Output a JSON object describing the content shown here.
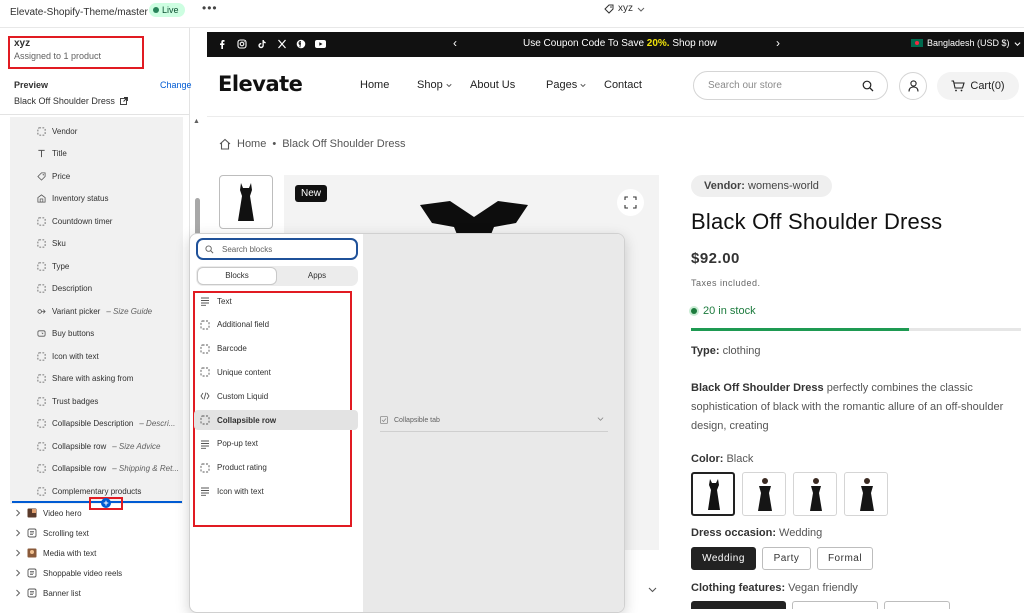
{
  "topbar": {
    "theme_name": "Elevate-Shopify-Theme/master",
    "live_label": "Live",
    "template_name": "xyz",
    "more_label": "•••"
  },
  "sidebar": {
    "template_title": "xyz",
    "template_sub": "Assigned to 1 product",
    "preview_label": "Preview",
    "preview_change": "Change",
    "preview_product": "Black Off Shoulder Dress",
    "blocks": [
      {
        "label": "Vendor",
        "sub": "",
        "icon": "dashed-square-icon"
      },
      {
        "label": "Title",
        "sub": "",
        "icon": "text-t-icon"
      },
      {
        "label": "Price",
        "sub": "",
        "icon": "price-tag-icon"
      },
      {
        "label": "Inventory status",
        "sub": "",
        "icon": "inventory-icon"
      },
      {
        "label": "Countdown timer",
        "sub": "",
        "icon": "dashed-square-icon"
      },
      {
        "label": "Sku",
        "sub": "",
        "icon": "dashed-square-icon"
      },
      {
        "label": "Type",
        "sub": "",
        "icon": "dashed-square-icon"
      },
      {
        "label": "Description",
        "sub": "",
        "icon": "dashed-square-icon"
      },
      {
        "label": "Variant picker",
        "sub": "Size Guide",
        "icon": "variant-picker-icon"
      },
      {
        "label": "Buy buttons",
        "sub": "",
        "icon": "buy-buttons-icon"
      },
      {
        "label": "Icon with text",
        "sub": "",
        "icon": "dashed-square-icon"
      },
      {
        "label": "Share with asking from",
        "sub": "",
        "icon": "dashed-square-icon"
      },
      {
        "label": "Trust badges",
        "sub": "",
        "icon": "dashed-square-icon"
      },
      {
        "label": "Collapsible Description",
        "sub": "Descri...",
        "icon": "dashed-square-icon"
      },
      {
        "label": "Collapsible row",
        "sub": "Size Advice",
        "icon": "dashed-square-icon"
      },
      {
        "label": "Collapsible row",
        "sub": "Shipping & Ret...",
        "icon": "dashed-square-icon"
      },
      {
        "label": "Complementary products",
        "sub": "",
        "icon": "dashed-square-icon"
      }
    ],
    "sections": [
      {
        "label": "Video hero",
        "icon": "video-thumb-icon"
      },
      {
        "label": "Scrolling text",
        "icon": "section-icon"
      },
      {
        "label": "Media with text",
        "icon": "media-thumb-icon"
      },
      {
        "label": "Shoppable video reels",
        "icon": "section-icon"
      },
      {
        "label": "Banner list",
        "icon": "section-icon"
      }
    ],
    "add_block_symbol": "+"
  },
  "store": {
    "announcement": {
      "text_pre": "Use Coupon Code To Save ",
      "highlight": "20%.",
      "text_post": " Shop now",
      "prev": "‹",
      "next": "›"
    },
    "country": "Bangladesh (USD $)",
    "logo": "Elevate",
    "nav": [
      "Home",
      "Shop",
      "About Us",
      "Pages",
      "Contact"
    ],
    "search_placeholder": "Search our store",
    "cart_label": "Cart(0)",
    "breadcrumb": {
      "home": "Home",
      "separator": "•",
      "current": "Black Off Shoulder Dress"
    },
    "new_badge": "New"
  },
  "product": {
    "vendor_label": "Vendor:",
    "vendor_value": " womens-world",
    "title": "Black Off Shoulder Dress",
    "price": "$92.00",
    "taxes": "Taxes included.",
    "stock_text": "20 in stock",
    "stock_fraction": 0.66,
    "type_label": "Type:",
    "type_value": " clothing",
    "desc_bold": "Black Off Shoulder Dress",
    "desc_rest": " perfectly combines the classic sophistication of black with the romantic allure of an off-shoulder design, creating",
    "color_label": "Color:",
    "color_value": " Black",
    "occasion_label": "Dress occasion:",
    "occasion_value": " Wedding",
    "occasions": [
      "Wedding",
      "Party",
      "Formal"
    ],
    "features_label": "Clothing features:",
    "features_value": " Vegan friendly"
  },
  "picker": {
    "search_placeholder": "Search blocks",
    "tab_blocks": "Blocks",
    "tab_apps": "Apps",
    "items": [
      {
        "label": "Text",
        "icon": "text-lines-icon"
      },
      {
        "label": "Additional field",
        "icon": "dashed-square-icon"
      },
      {
        "label": "Barcode",
        "icon": "dashed-square-icon"
      },
      {
        "label": "Unique content",
        "icon": "dashed-square-icon"
      },
      {
        "label": "Custom Liquid",
        "icon": "code-icon"
      },
      {
        "label": "Collapsible row",
        "icon": "dashed-square-icon"
      },
      {
        "label": "Pop-up text",
        "icon": "text-lines-icon"
      },
      {
        "label": "Product rating",
        "icon": "dashed-square-icon"
      },
      {
        "label": "Icon with text",
        "icon": "text-lines-icon"
      }
    ],
    "collapsible_tab_label": "Collapsible tab"
  },
  "colors": {
    "accent": "#005bd3",
    "highlight_border": "#e11b22",
    "stock_green": "#1c7b3d",
    "live_bg": "#cdfee1"
  }
}
